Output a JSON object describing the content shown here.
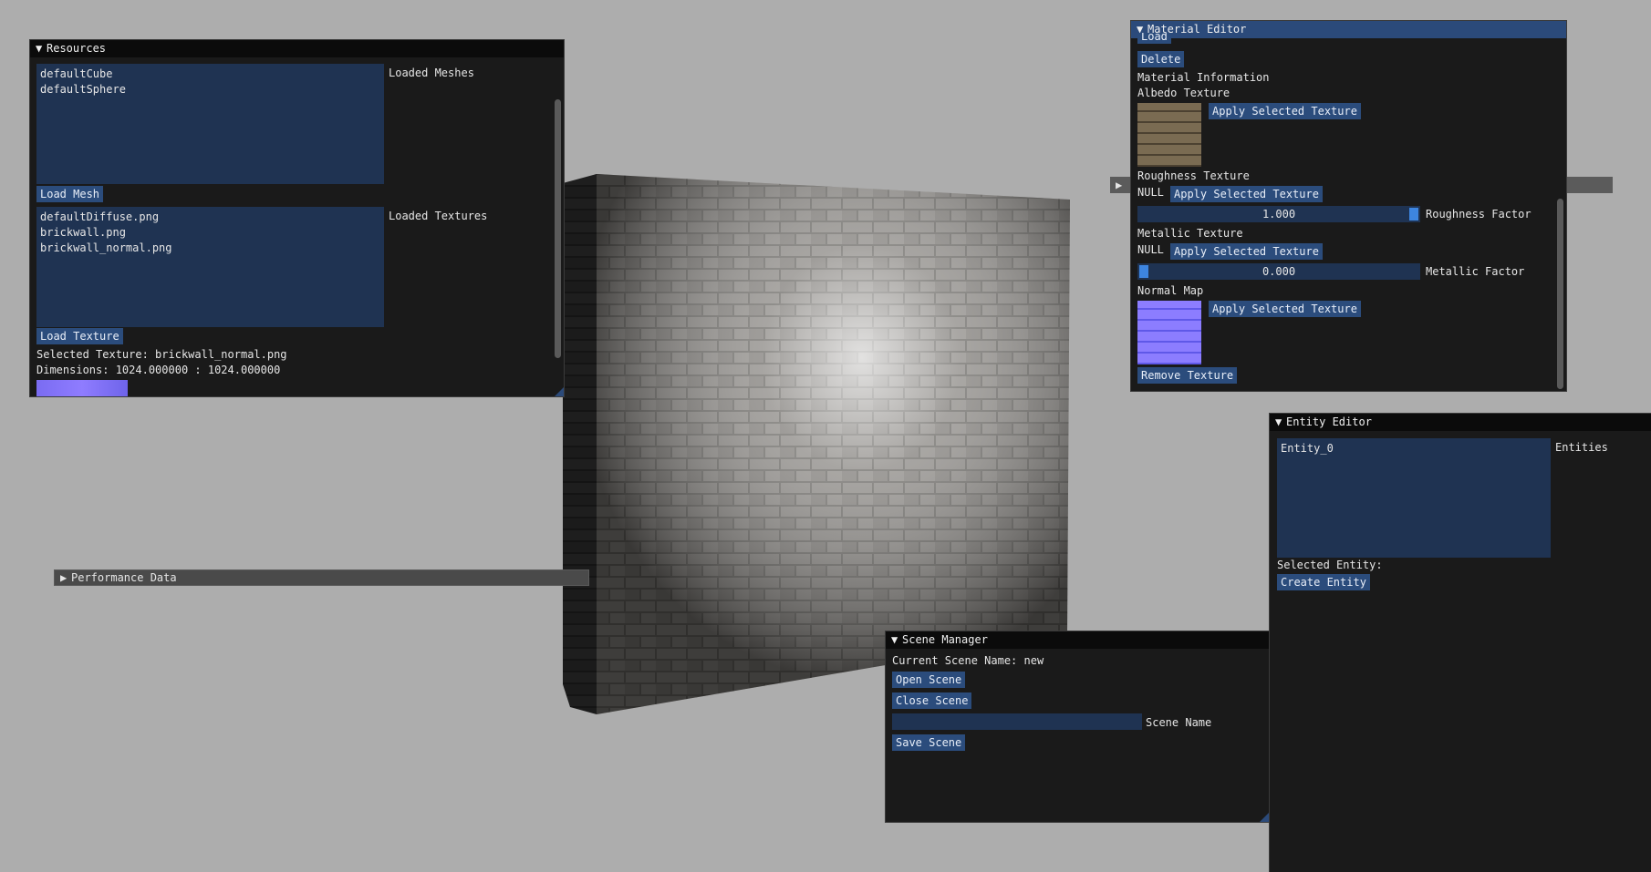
{
  "resources": {
    "title": "Resources",
    "meshes_label": "Loaded Meshes",
    "meshes": [
      "defaultCube",
      "defaultSphere"
    ],
    "load_mesh": "Load Mesh",
    "textures_label": "Loaded Textures",
    "textures": [
      "defaultDiffuse.png",
      "brickwall.png",
      "brickwall_normal.png"
    ],
    "load_texture": "Load Texture",
    "selected_texture": "Selected Texture: brickwall_normal.png",
    "dimensions": "Dimensions: 1024.000000 : 1024.000000"
  },
  "performance": {
    "title": "Performance Data"
  },
  "material_editor": {
    "title": "Material Editor",
    "load": "Load",
    "delete": "Delete",
    "info": "Material Information",
    "albedo_label": "Albedo Texture",
    "apply": "Apply Selected Texture",
    "roughness_label": "Roughness Texture",
    "roughness_null": "NULL",
    "roughness_value": "1.000",
    "roughness_factor": "Roughness Factor",
    "metallic_label": "Metallic Texture",
    "metallic_null": "NULL",
    "metallic_value": "0.000",
    "metallic_factor": "Metallic Factor",
    "normal_label": "Normal Map",
    "remove_texture": "Remove Texture"
  },
  "entity_editor": {
    "title": "Entity Editor",
    "entities": [
      "Entity_0"
    ],
    "entities_label": "Entities",
    "selected_entity": "Selected Entity:",
    "create_entity": "Create Entity"
  },
  "scene_manager": {
    "title": "Scene Manager",
    "current_scene": "Current Scene Name: new",
    "open_scene": "Open Scene",
    "close_scene": "Close Scene",
    "scene_name_label": "Scene Name",
    "scene_name_value": "",
    "save_scene": "Save Scene"
  },
  "colors": {
    "background": "#adadad",
    "window_bg": "#1a1a1a",
    "title_active": "#2b4a7a",
    "button": "#2b4c7c",
    "frame": "#1f3352",
    "accent": "#3d85e0"
  }
}
